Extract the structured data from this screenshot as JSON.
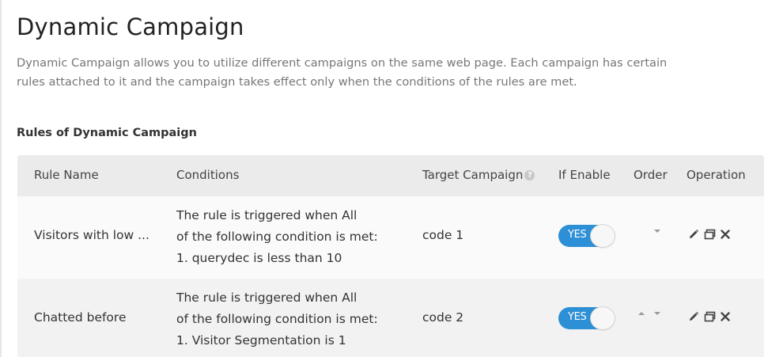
{
  "page": {
    "title": "Dynamic Campaign",
    "description_line1": "Dynamic Campaign allows you to utilize different campaigns on the same web page. Each campaign has certain",
    "description_line2": "rules attached to it and the campaign takes effect only when the conditions of the rules are met.",
    "section_title": "Rules of Dynamic Campaign"
  },
  "table": {
    "headers": {
      "rule_name": "Rule Name",
      "conditions": "Conditions",
      "target_campaign": "Target Campaign",
      "target_campaign_help_icon": "question-circle-icon",
      "if_enable": "If Enable",
      "order": "Order",
      "operation": "Operation"
    },
    "rows": [
      {
        "rule_name": "Visitors with low ...",
        "conditions": [
          "The rule is triggered when All",
          "of the following  condition is met:",
          "1. querydec is less than 10"
        ],
        "target_campaign": "code 1",
        "enabled_label": "YES",
        "order_controls": [
          "down-arrow-icon"
        ],
        "operations": [
          "edit-pencil-icon",
          "copy-icon",
          "delete-x-icon"
        ]
      },
      {
        "rule_name": "Chatted before",
        "conditions": [
          "The rule is triggered when All",
          "of the following  condition is met:",
          "1. Visitor Segmentation is 1"
        ],
        "target_campaign": "code 2",
        "enabled_label": "YES",
        "order_controls": [
          "up-arrow-icon",
          "down-arrow-icon"
        ],
        "operations": [
          "edit-pencil-icon",
          "copy-icon",
          "delete-x-icon"
        ]
      }
    ]
  },
  "colors": {
    "toggle_on": "#2d8fd5",
    "header_bg": "#ebebeb",
    "row_odd_bg": "#fafafa",
    "row_even_bg": "#f2f2f2"
  }
}
